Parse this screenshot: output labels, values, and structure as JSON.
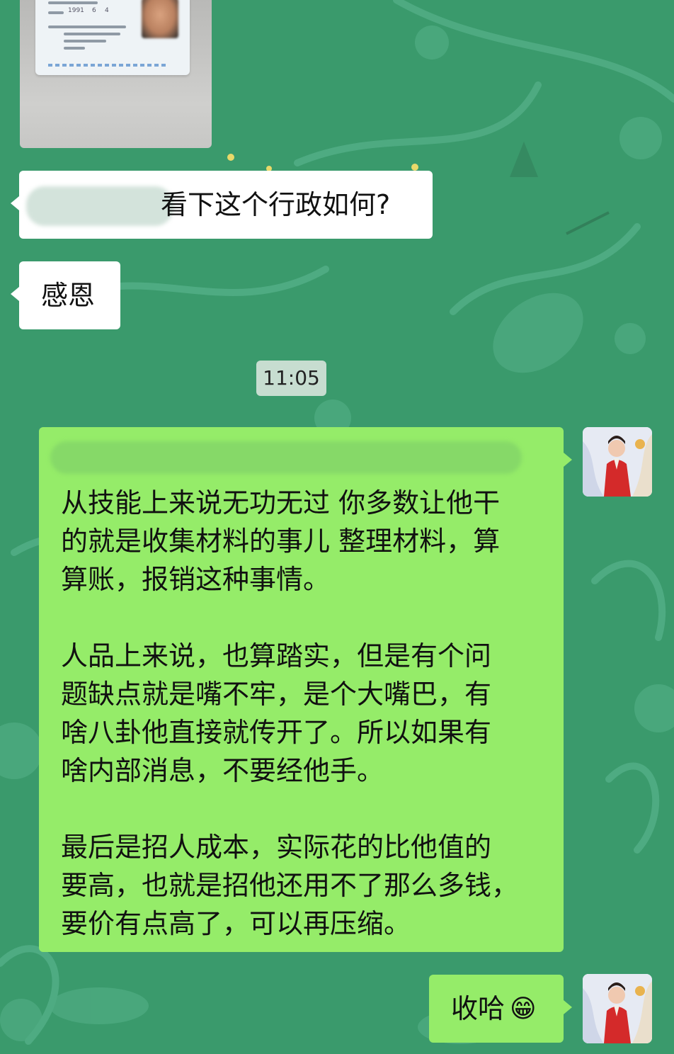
{
  "conversation": {
    "messages": [
      {
        "from": "other",
        "type": "image",
        "alt": "ID card photo (blurred)",
        "visible_text": [
          "1991",
          "6",
          "4"
        ]
      },
      {
        "from": "other",
        "type": "text",
        "text": "看下这个行政如何?"
      },
      {
        "from": "other",
        "type": "text",
        "text": "感恩"
      },
      {
        "from": "system",
        "type": "timestamp",
        "text": "11:05"
      },
      {
        "from": "self",
        "type": "text",
        "text": "从技能上来说无功无过 你多数让他干\n的就是收集材料的事儿 整理材料，算\n算账，报销这种事情。\n\n人品上来说，也算踏实，但是有个问\n题缺点就是嘴不牢，是个大嘴巴，有\n啥八卦他直接就传开了。所以如果有\n啥内部消息，不要经他手。\n\n最后是招人成本，实际花的比他值的\n要高，也就是招他还用不了那么多钱，\n要价有点高了，可以再压缩。"
      },
      {
        "from": "self",
        "type": "text",
        "text": "收哈",
        "emoji": "😁"
      }
    ]
  },
  "colors": {
    "background": "#3a9a6c",
    "bubble_other": "#ffffff",
    "bubble_self": "#95ec69",
    "timestamp_bg": "#c7ddd0"
  },
  "icons": {
    "self_avatar": "avatar-woman-red-hanfu"
  }
}
